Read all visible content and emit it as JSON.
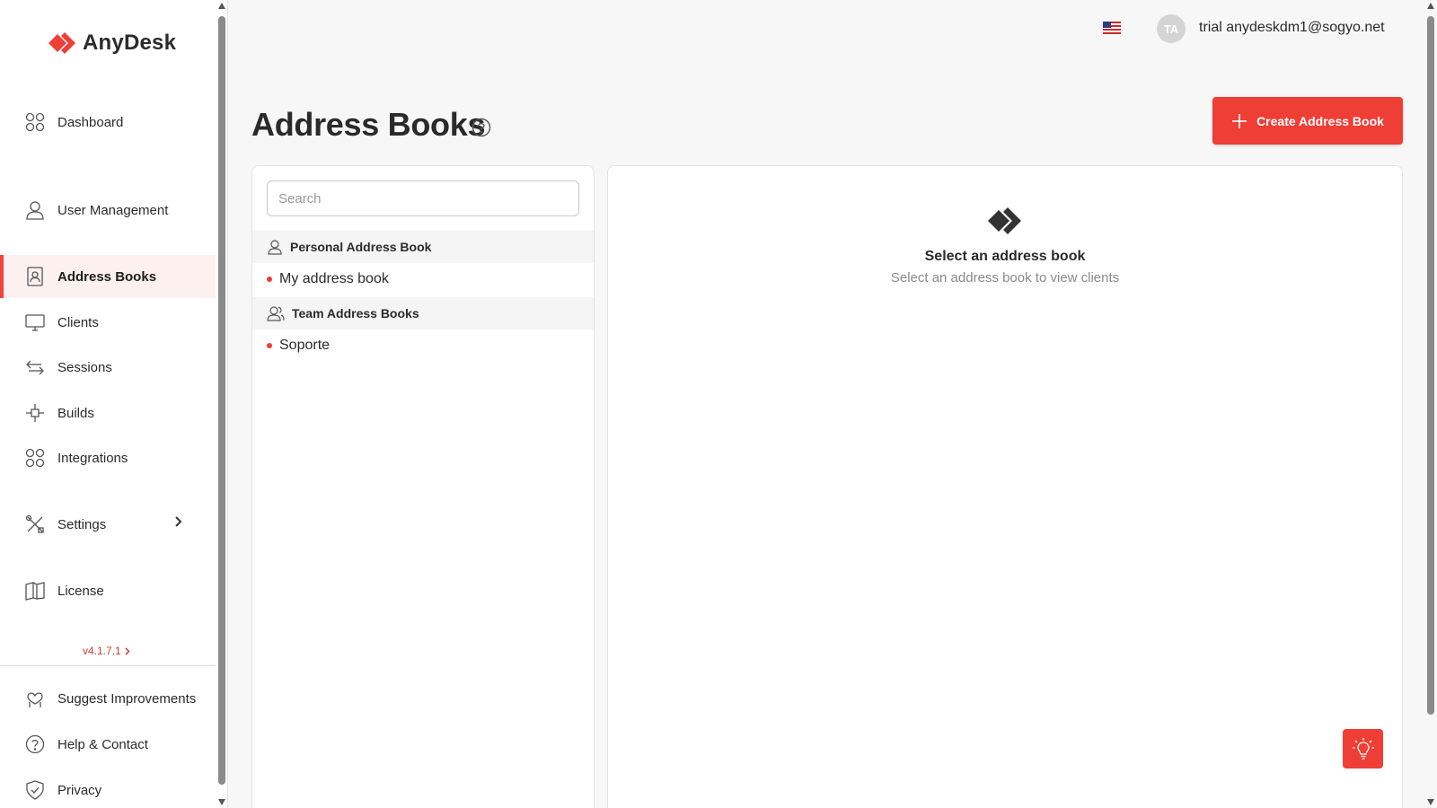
{
  "app": {
    "logo_text": "AnyDesk"
  },
  "sidebar": {
    "items": [
      {
        "label": "Dashboard",
        "icon": "grid-circles-icon"
      },
      {
        "label": "User Management",
        "icon": "user-icon"
      },
      {
        "label": "Address Books",
        "icon": "address-book-icon",
        "active": true
      },
      {
        "label": "Clients",
        "icon": "monitor-icon"
      },
      {
        "label": "Sessions",
        "icon": "arrows-exchange-icon"
      },
      {
        "label": "Builds",
        "icon": "build-icon"
      },
      {
        "label": "Integrations",
        "icon": "grid-circles-icon"
      },
      {
        "label": "Settings",
        "icon": "tools-icon"
      },
      {
        "label": "License",
        "icon": "book-icon"
      }
    ],
    "version": "v4.1.7.1",
    "footer_items": [
      {
        "label": "Suggest Improvements",
        "icon": "suggest-icon"
      },
      {
        "label": "Help & Contact",
        "icon": "question-circle-icon"
      },
      {
        "label": "Privacy",
        "icon": "shield-check-icon"
      }
    ]
  },
  "header": {
    "avatar_initials": "TA",
    "user_name": "trial anydeskdm1@sogyo.net"
  },
  "page": {
    "title": "Address Books",
    "create_button_label": "Create Address Book"
  },
  "list": {
    "search_placeholder": "Search",
    "personal_section": "Personal Address Book",
    "personal_books": [
      "My address book"
    ],
    "team_section": "Team Address Books",
    "team_books": [
      "Soporte"
    ]
  },
  "detail": {
    "empty_title": "Select an address book",
    "empty_subtitle": "Select an address book to view clients"
  },
  "colors": {
    "accent": "#ef3e36",
    "active_bg": "#fdf1f0"
  }
}
